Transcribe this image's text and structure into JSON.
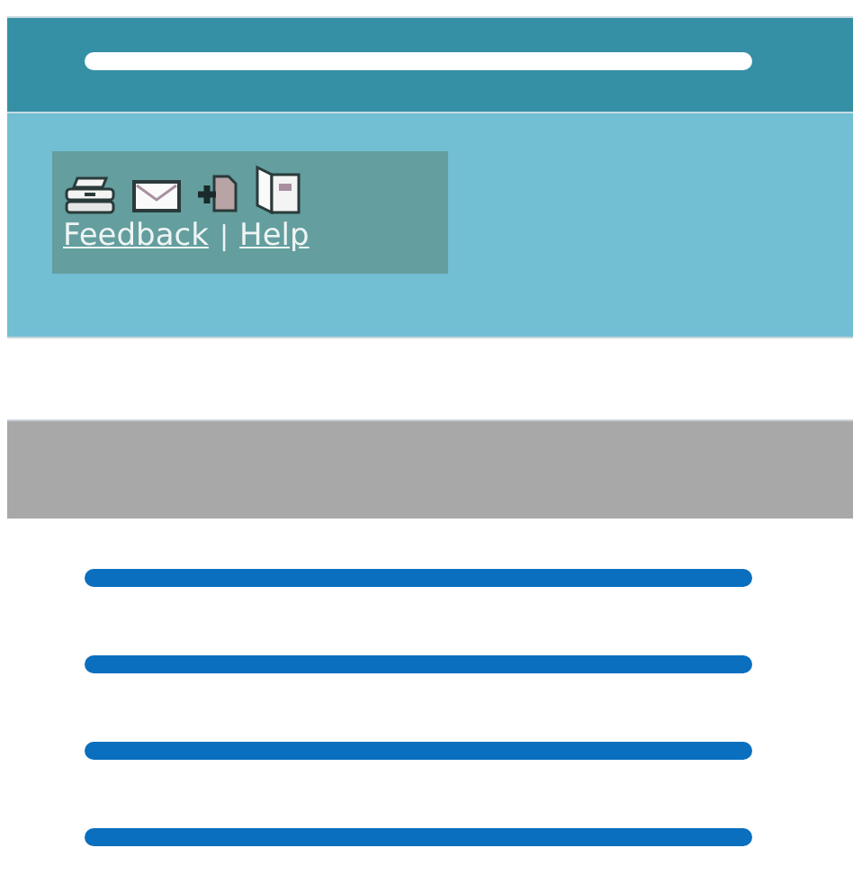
{
  "toolbar": {
    "links": [
      {
        "label": "Feedback"
      },
      {
        "label": "Help"
      }
    ],
    "separator": "|"
  }
}
